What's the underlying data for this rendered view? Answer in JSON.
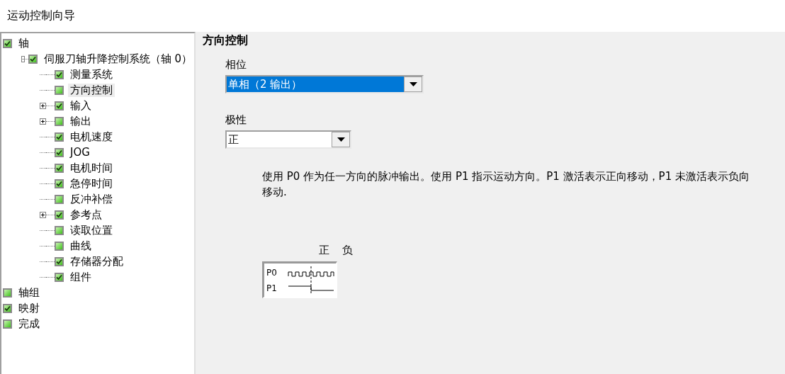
{
  "window": {
    "title": "运动控制向导"
  },
  "tree": [
    {
      "label": "轴",
      "checked": true,
      "selected": false,
      "children": [
        {
          "label": "伺服刀轴升降控制系统（轴 0）",
          "checked": true,
          "selected": false,
          "expanded": true,
          "children": [
            {
              "label": "测量系统",
              "checked": true,
              "selected": false
            },
            {
              "label": "方向控制",
              "checked": false,
              "selected": true
            },
            {
              "label": "输入",
              "checked": true,
              "selected": false,
              "expanded": false
            },
            {
              "label": "输出",
              "checked": false,
              "selected": false,
              "expanded": false
            },
            {
              "label": "电机速度",
              "checked": true,
              "selected": false
            },
            {
              "label": "JOG",
              "checked": true,
              "selected": false
            },
            {
              "label": "电机时间",
              "checked": true,
              "selected": false
            },
            {
              "label": "急停时间",
              "checked": true,
              "selected": false
            },
            {
              "label": "反冲补偿",
              "checked": false,
              "selected": false
            },
            {
              "label": "参考点",
              "checked": true,
              "selected": false,
              "expanded": false
            },
            {
              "label": "读取位置",
              "checked": false,
              "selected": false
            },
            {
              "label": "曲线",
              "checked": false,
              "selected": false
            },
            {
              "label": "存储器分配",
              "checked": true,
              "selected": false
            },
            {
              "label": "组件",
              "checked": true,
              "selected": false
            }
          ]
        }
      ]
    },
    {
      "label": "轴组",
      "checked": false,
      "selected": false
    },
    {
      "label": "映射",
      "checked": true,
      "selected": false
    },
    {
      "label": "完成",
      "checked": false,
      "selected": false
    }
  ],
  "panel": {
    "heading": "方向控制",
    "fields": [
      {
        "label": "相位",
        "value": "单相（2 输出）",
        "highlighted": true
      },
      {
        "label": "极性",
        "value": "正",
        "highlighted": false
      }
    ],
    "description": "使用 P0 作为任一方向的脉冲输出。使用 P1 指示运动方向。P1 激活表示正向移动，P1 未激活表示负向移动.",
    "diagram": {
      "direction_labels": [
        "正",
        "负"
      ],
      "signals": [
        "P0",
        "P1"
      ]
    }
  }
}
